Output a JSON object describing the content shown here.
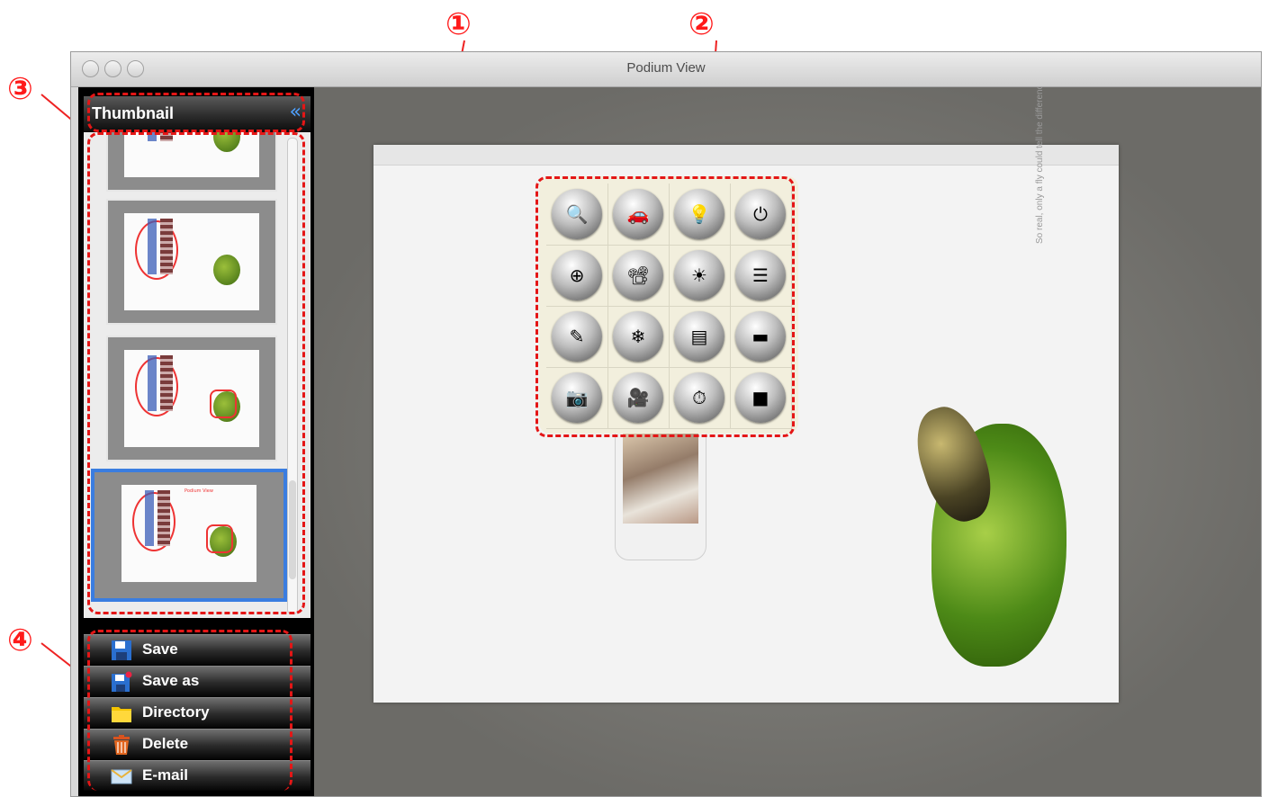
{
  "window": {
    "title": "Podium View"
  },
  "callouts": [
    "①",
    "②",
    "③",
    "④"
  ],
  "sidebar": {
    "header": {
      "title": "Thumbnail",
      "collapse_icon": "double-chevron-left-icon"
    },
    "thumbnails": [
      {
        "label": ""
      },
      {
        "label": ""
      },
      {
        "label": ""
      },
      {
        "label": "Podium View"
      }
    ],
    "selected_thumbnail": 3,
    "buttons": [
      {
        "label": "Save",
        "icon": "floppy-disk-icon"
      },
      {
        "label": "Save as",
        "icon": "floppy-disk-star-icon"
      },
      {
        "label": "Directory",
        "icon": "folder-icon"
      },
      {
        "label": "Delete",
        "icon": "trash-icon"
      },
      {
        "label": "E-mail",
        "icon": "envelope-icon"
      }
    ]
  },
  "document": {
    "tagline": "So real, only a fly could tell the difference."
  },
  "toolbar": {
    "buttons": [
      {
        "name": "zoom-document-icon",
        "glyph": "🔍"
      },
      {
        "name": "car-icon",
        "glyph": "🚗"
      },
      {
        "name": "lamp-icon",
        "glyph": "💡"
      },
      {
        "name": "power-icon",
        "glyph": "⏻"
      },
      {
        "name": "zoom-in-icon",
        "glyph": "⊕"
      },
      {
        "name": "document-camera-icon",
        "glyph": "📽"
      },
      {
        "name": "brightness-icon",
        "glyph": "☀"
      },
      {
        "name": "settings-list-icon",
        "glyph": "☰"
      },
      {
        "name": "annotation-pen-icon",
        "glyph": "✎"
      },
      {
        "name": "freeze-icon",
        "glyph": "❄"
      },
      {
        "name": "note-icon",
        "glyph": "▤"
      },
      {
        "name": "full-screen-icon",
        "glyph": "▬"
      },
      {
        "name": "capture-camera-icon",
        "glyph": "📷"
      },
      {
        "name": "record-video-icon",
        "glyph": "🎥"
      },
      {
        "name": "timer-icon",
        "glyph": "⏱"
      },
      {
        "name": "stop-icon",
        "glyph": "■"
      }
    ]
  }
}
